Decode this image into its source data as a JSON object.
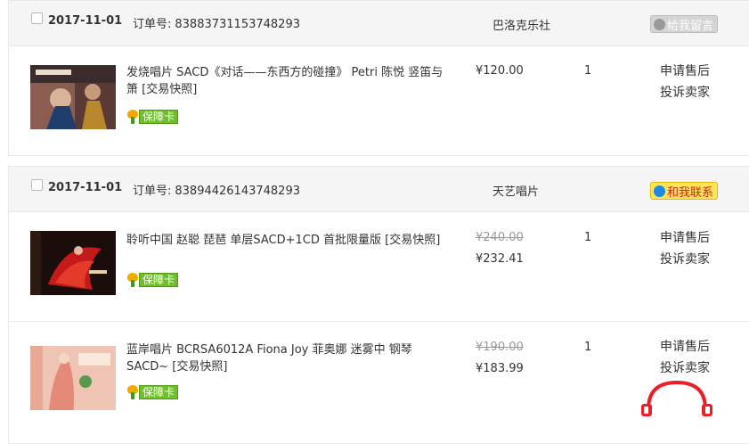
{
  "orders": [
    {
      "date": "2017-11-01",
      "order_label": "订单号:",
      "order_no": "83883731153748293",
      "shop": "巴洛克乐社",
      "chat_label": "给我留言",
      "items": [
        {
          "title": "发烧唱片 SACD《对话——东西方的碰撞》 Petri 陈悦 竖笛与箫 [交易快照]",
          "old_price": "",
          "price": "¥120.00",
          "qty": "1",
          "badge": "保障卡",
          "actions": [
            "申请售后",
            "投诉卖家"
          ]
        }
      ]
    },
    {
      "date": "2017-11-01",
      "order_label": "订单号:",
      "order_no": "83894426143748293",
      "shop": "天艺唱片",
      "chat_label": "和我联系",
      "items": [
        {
          "title": "聆听中国 赵聪 琵琶 单层SACD+1CD 首批限量版 [交易快照]",
          "old_price": "¥240.00",
          "price": "¥232.41",
          "qty": "1",
          "badge": "保障卡",
          "actions": [
            "申请售后",
            "投诉卖家"
          ]
        },
        {
          "title": "蓝岸唱片 BCRSA6012A Fiona Joy 菲奥娜 迷雾中 钢琴 SACD~ [交易快照]",
          "old_price": "¥190.00",
          "price": "¥183.99",
          "qty": "1",
          "badge": "保障卡",
          "actions": [
            "申请售后",
            "投诉卖家"
          ]
        }
      ]
    }
  ],
  "colors": {
    "accent": "#e8202a",
    "badge_green": "#6fbf2a",
    "header_bg": "#f5f5f5"
  }
}
